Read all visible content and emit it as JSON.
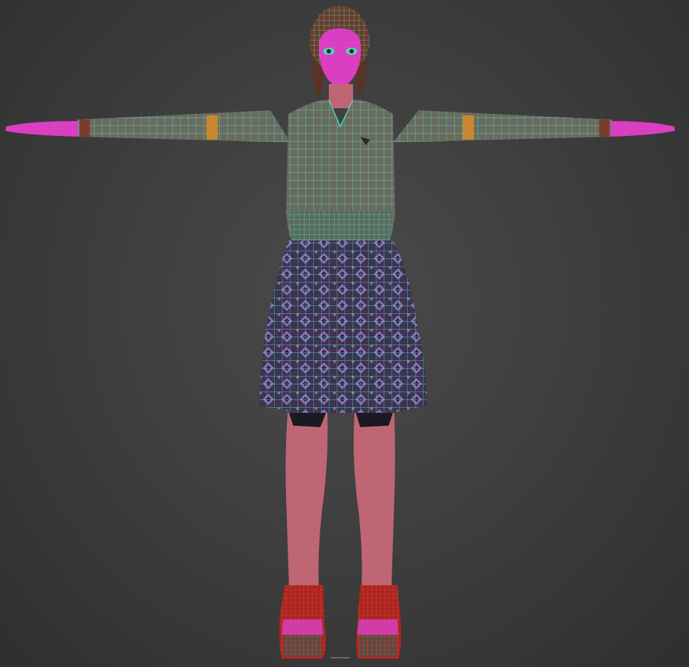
{
  "viewport": {
    "background": "#3c3c3c",
    "shading_mode": "wireframe-over-shaded"
  },
  "model": {
    "pose": "T-pose",
    "wire_colors": {
      "clothing": "#45e6c8",
      "skin": "#e62fc4",
      "shoes": "#ff2a2a"
    },
    "surface_colors": {
      "top": "#6b6a5e",
      "skin": "#b86a6a",
      "skirt": "#4a3c5a",
      "skirt_pattern": "#a57bd0",
      "shoe": "#a8261f",
      "cuff_band": "#c8872e",
      "hair": "#6a3c2c"
    }
  }
}
